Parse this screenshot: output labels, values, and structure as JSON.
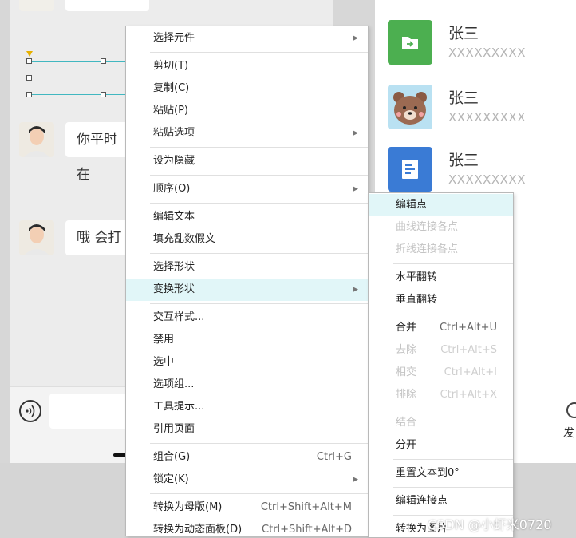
{
  "chat": {
    "message_1": "你平时在",
    "message_2": "哦 会打"
  },
  "contacts": [
    {
      "name": "张三",
      "sub": "XXXXXXXXX",
      "icon": "folder-arrow-icon",
      "color": "#4caf50"
    },
    {
      "name": "张三",
      "sub": "XXXXXXXXX",
      "icon": "bear-avatar-icon",
      "color": "#b9e1f2"
    },
    {
      "name": "张三",
      "sub": "XXXXXXXXX",
      "icon": "document-icon",
      "color": "#3a7bd5"
    }
  ],
  "side_label": "发",
  "watermark": "CSDN @小虾米0720",
  "main_menu": [
    {
      "label": "选择元件",
      "submenu": true
    },
    {
      "sep": true
    },
    {
      "label": "剪切(T)"
    },
    {
      "label": "复制(C)"
    },
    {
      "label": "粘贴(P)"
    },
    {
      "label": "粘贴选项",
      "submenu": true
    },
    {
      "sep": true
    },
    {
      "label": "设为隐藏"
    },
    {
      "sep": true
    },
    {
      "label": "顺序(O)",
      "submenu": true
    },
    {
      "sep": true
    },
    {
      "label": "编辑文本"
    },
    {
      "label": "填充乱数假文"
    },
    {
      "sep": true
    },
    {
      "label": "选择形状"
    },
    {
      "label": "变换形状",
      "submenu": true,
      "highlight": true
    },
    {
      "sep": true
    },
    {
      "label": "交互样式..."
    },
    {
      "label": "禁用"
    },
    {
      "label": "选中"
    },
    {
      "label": "选项组..."
    },
    {
      "label": "工具提示..."
    },
    {
      "label": "引用页面"
    },
    {
      "sep": true
    },
    {
      "label": "组合(G)",
      "shortcut": "Ctrl+G"
    },
    {
      "label": "锁定(K)",
      "submenu": true
    },
    {
      "sep": true
    },
    {
      "label": "转换为母版(M)",
      "shortcut": "Ctrl+Shift+Alt+M"
    },
    {
      "label": "转换为动态面板(D)",
      "shortcut": "Ctrl+Shift+Alt+D"
    }
  ],
  "sub_menu": [
    {
      "label": "编辑点",
      "highlight": true
    },
    {
      "label": "曲线连接各点",
      "disabled": true
    },
    {
      "label": "折线连接各点",
      "disabled": true
    },
    {
      "sep": true
    },
    {
      "label": "水平翻转"
    },
    {
      "label": "垂直翻转"
    },
    {
      "sep": true
    },
    {
      "label": "合并",
      "shortcut": "Ctrl+Alt+U"
    },
    {
      "label": "去除",
      "shortcut": "Ctrl+Alt+S",
      "disabled": true
    },
    {
      "label": "相交",
      "shortcut": "Ctrl+Alt+I",
      "disabled": true
    },
    {
      "label": "排除",
      "shortcut": "Ctrl+Alt+X",
      "disabled": true
    },
    {
      "sep": true
    },
    {
      "label": "结合",
      "disabled": true
    },
    {
      "label": "分开"
    },
    {
      "sep": true
    },
    {
      "label": "重置文本到0°"
    },
    {
      "sep": true
    },
    {
      "label": "编辑连接点"
    },
    {
      "sep": true
    },
    {
      "label": "转换为图片"
    }
  ]
}
